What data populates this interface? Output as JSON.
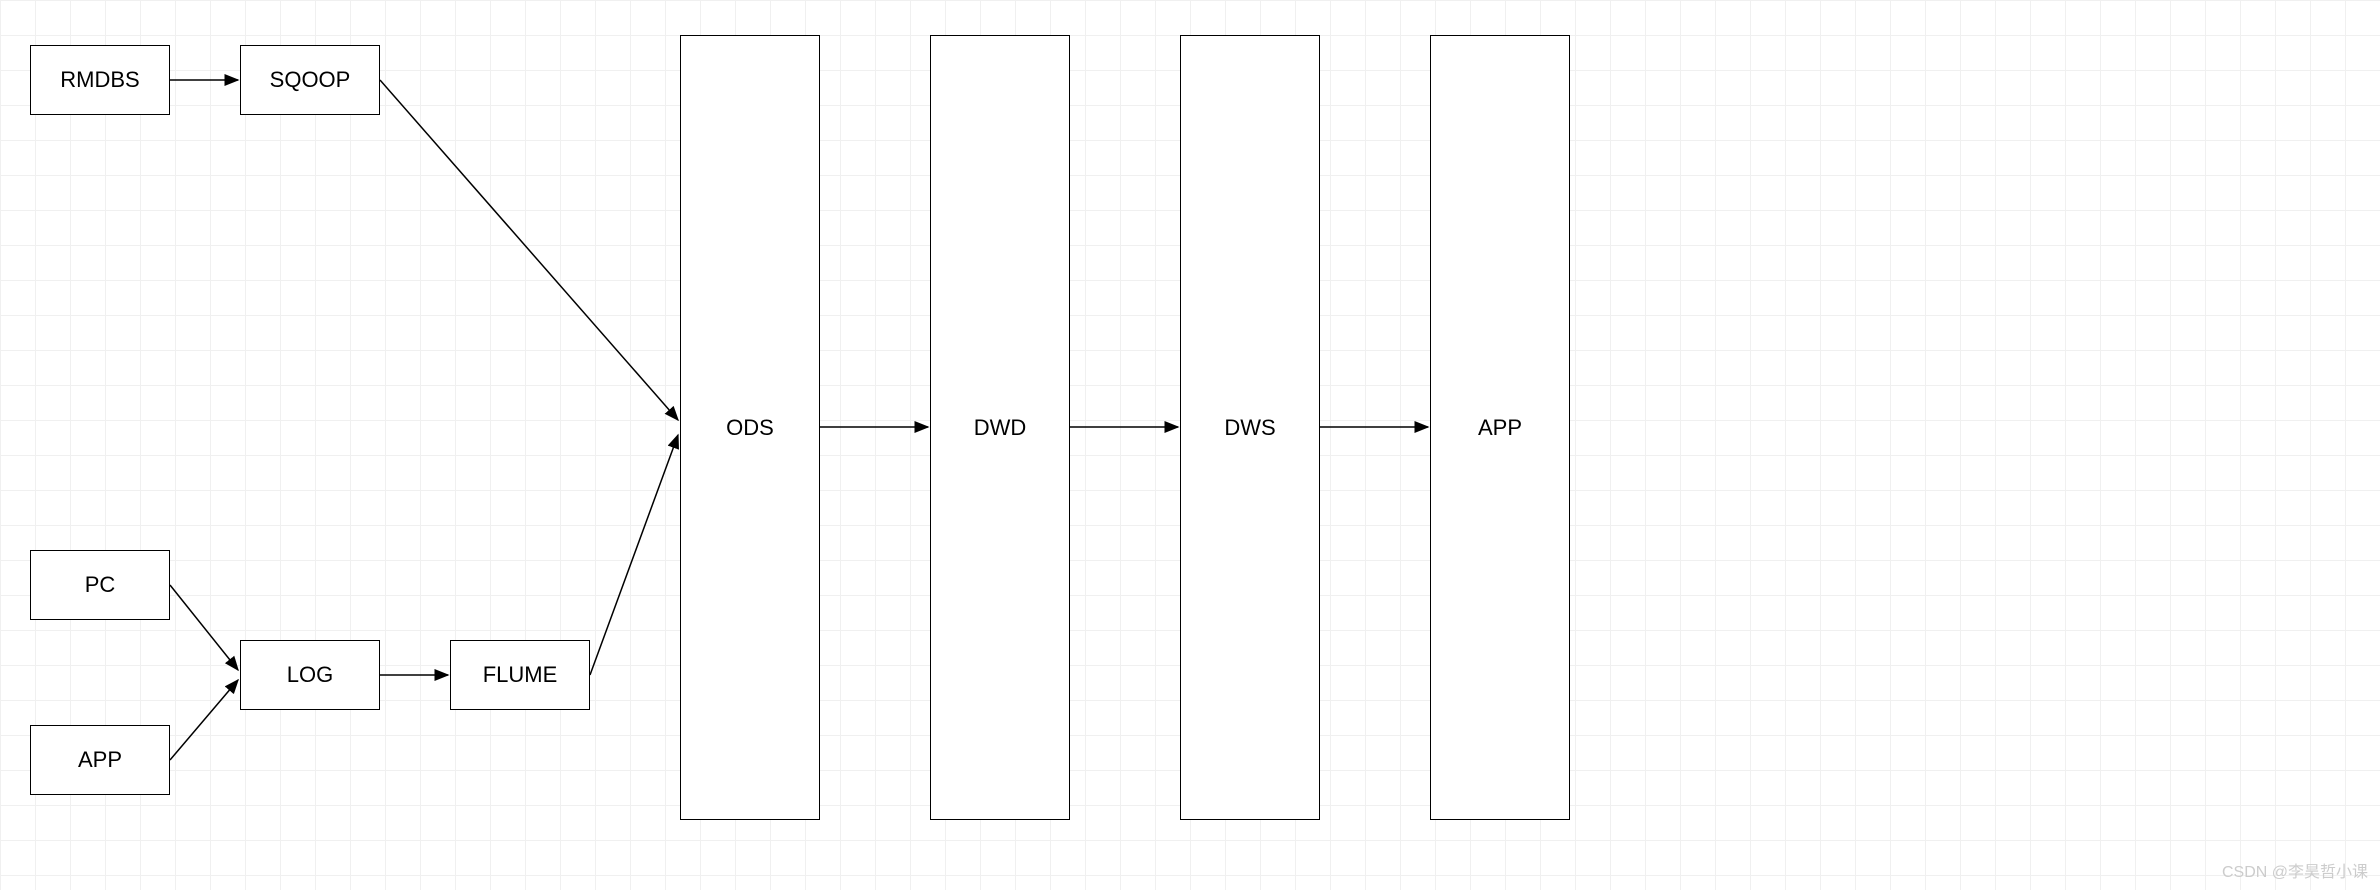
{
  "nodes": {
    "rmdbs": {
      "label": "RMDBS"
    },
    "sqoop": {
      "label": "SQOOP"
    },
    "pc": {
      "label": "PC"
    },
    "app_src": {
      "label": "APP"
    },
    "log": {
      "label": "LOG"
    },
    "flume": {
      "label": "FLUME"
    },
    "ods": {
      "label": "ODS"
    },
    "dwd": {
      "label": "DWD"
    },
    "dws": {
      "label": "DWS"
    },
    "app_out": {
      "label": "APP"
    }
  },
  "watermark": "CSDN @李昊哲小课"
}
